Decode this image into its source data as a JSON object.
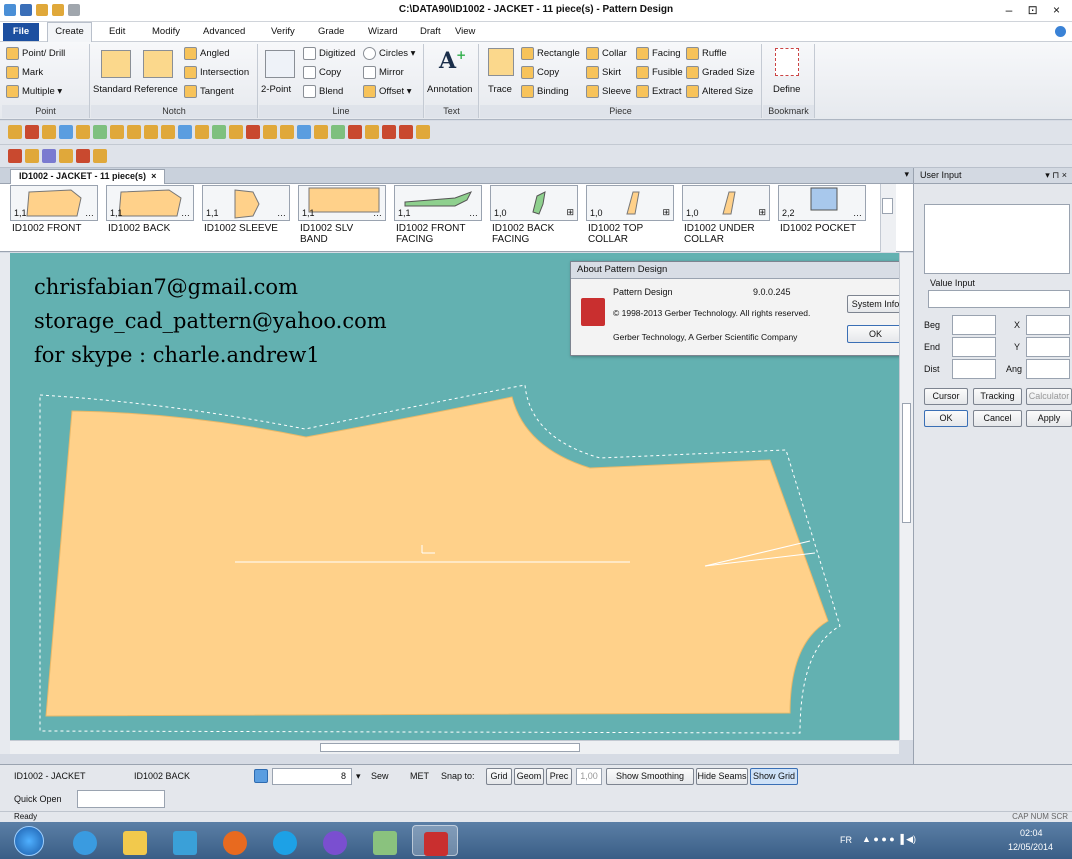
{
  "window": {
    "title": "C:\\DATA90\\ID1002 - JACKET  -  11 piece(s) - Pattern Design",
    "controls": "– ⊡ ×"
  },
  "menu": {
    "file": "File",
    "tabs": [
      "Create",
      "Edit",
      "Modify",
      "Advanced",
      "Verify",
      "Grade",
      "Wizard",
      "Draft",
      "View"
    ]
  },
  "ribbon": {
    "point": {
      "label": "Point",
      "items": [
        "Point/ Drill",
        "Mark",
        "Multiple ▾"
      ]
    },
    "notch": {
      "label": "Notch",
      "standard": "Standard",
      "reference": "Reference",
      "items": [
        "Angled",
        "Intersection",
        "Tangent"
      ]
    },
    "line": {
      "label": "Line",
      "twopoint": "2-Point",
      "items": [
        "Digitized",
        "Copy",
        "Blend",
        "Circles ▾",
        "Mirror",
        "Offset ▾"
      ]
    },
    "text": {
      "label": "Text",
      "annotation": "Annotation"
    },
    "piece": {
      "label": "Piece",
      "trace": "Trace",
      "items": [
        "Rectangle",
        "Copy",
        "Binding",
        "Collar",
        "Skirt",
        "Sleeve",
        "Facing",
        "Fusible",
        "Extract",
        "Ruffle",
        "Graded Size",
        "Altered Size"
      ]
    },
    "bookmark": {
      "label": "Bookmark",
      "define": "Define"
    }
  },
  "doc_tab": {
    "label": "ID1002 - JACKET  -  11 piece(s)",
    "close": "×"
  },
  "pieces": [
    {
      "qty": "1,1",
      "name": "ID1002 FRONT"
    },
    {
      "qty": "1,1",
      "name": "ID1002 BACK"
    },
    {
      "qty": "1,1",
      "name": "ID1002 SLEEVE"
    },
    {
      "qty": "1,1",
      "name": "ID1002 SLV BAND"
    },
    {
      "qty": "1,1",
      "name": "ID1002 FRONT FACING"
    },
    {
      "qty": "1,0",
      "name": "ID1002 BACK FACING"
    },
    {
      "qty": "1,0",
      "name": "ID1002 TOP COLLAR"
    },
    {
      "qty": "1,0",
      "name": "ID1002 UNDER COLLAR"
    },
    {
      "qty": "2,2",
      "name": "ID1002 POCKET"
    }
  ],
  "overlay": {
    "line1": "chrisfabian7@gmail.com",
    "line2": "storage_cad_pattern@yahoo.com",
    "line3": "for skype :  charle.andrew1"
  },
  "about": {
    "title": "About Pattern Design",
    "product": "Pattern Design",
    "version": "9.0.0.245",
    "copyright": "© 1998-2013 Gerber Technology. All rights reserved.",
    "company": "Gerber Technology, A Gerber Scientific Company",
    "sysinfo": "System Info",
    "ok": "OK"
  },
  "panel": {
    "title": "User Input",
    "value_input": "Value Input",
    "beg": "Beg",
    "end": "End",
    "dist": "Dist",
    "x": "X",
    "y": "Y",
    "ang": "Ang",
    "cursor": "Cursor",
    "tracking": "Tracking",
    "calculator": "Calculator",
    "ok": "OK",
    "cancel": "Cancel",
    "apply": "Apply"
  },
  "status": {
    "doc": "ID1002 - JACKET",
    "piece": "ID1002 BACK",
    "num": "8",
    "sew": "Sew",
    "unit": "MET",
    "snap": "Snap to:",
    "grid": "Grid",
    "geom": "Geom",
    "prec": "Prec",
    "prec_val": "1,00",
    "smoothing": "Show Smoothing",
    "seams": "Hide Seams",
    "showgrid": "Show Grid"
  },
  "quickopen": {
    "label": "Quick Open",
    "ready": "Ready",
    "indicators": "CAP  NUM  SCR"
  },
  "taskbar": {
    "lang": "FR",
    "time": "02:04",
    "date": "12/05/2014"
  },
  "colors": {
    "piece_fill": "#ffd18a",
    "canvas_bg": "#63b1b1",
    "accent": "#1c4fa0"
  }
}
